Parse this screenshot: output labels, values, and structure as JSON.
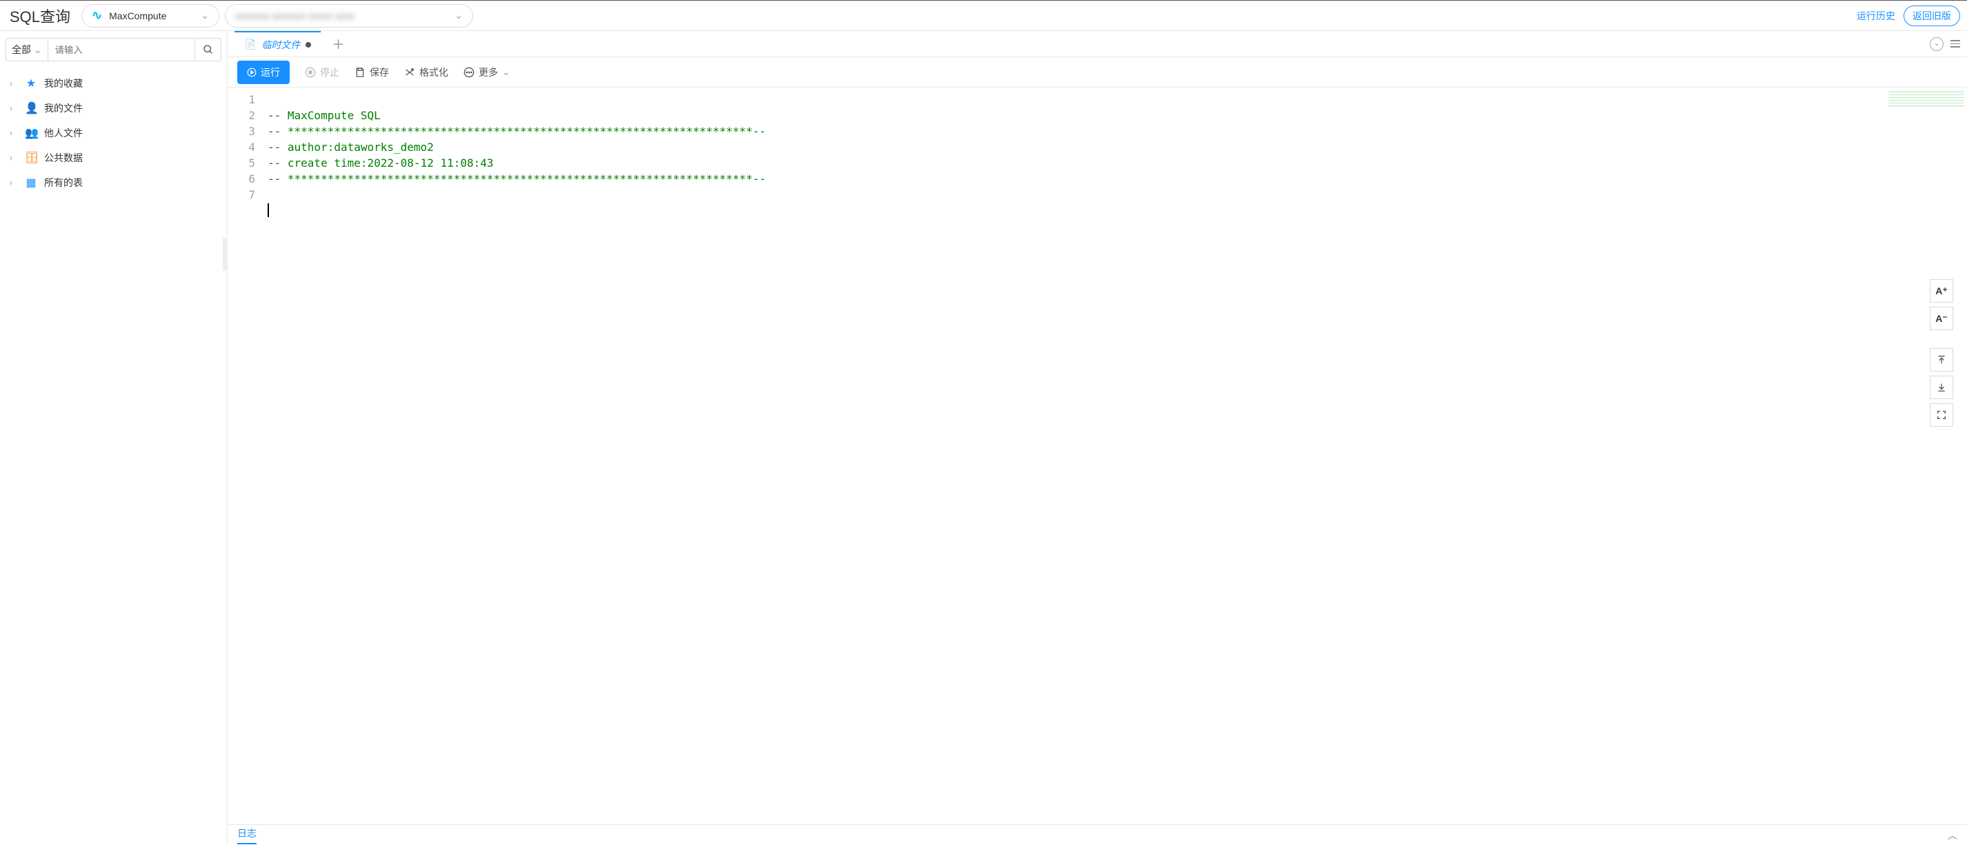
{
  "header": {
    "title": "SQL查询",
    "engine": "MaxCompute",
    "workspace_blur": "xxxxxxx  xxxxxxx  xxxxx  xxxx",
    "history_link": "运行历史",
    "return_old": "返回旧版"
  },
  "sidebar": {
    "scope": "全部",
    "search_placeholder": "请输入",
    "items": [
      {
        "icon": "star",
        "label": "我的收藏"
      },
      {
        "icon": "user",
        "label": "我的文件"
      },
      {
        "icon": "users",
        "label": "他人文件"
      },
      {
        "icon": "db",
        "label": "公共数据"
      },
      {
        "icon": "grid",
        "label": "所有的表"
      }
    ]
  },
  "tabs": {
    "active": "临时文件"
  },
  "toolbar": {
    "run": "运行",
    "stop": "停止",
    "save": "保存",
    "format": "格式化",
    "more": "更多"
  },
  "editor": {
    "lines": [
      "-- MaxCompute SQL",
      "-- **********************************************************************--",
      "-- author:dataworks_demo2",
      "-- create time:2022-08-12 11:08:43",
      "-- **********************************************************************--",
      "",
      ""
    ]
  },
  "side_tools": {
    "zoom_in": "A⁺",
    "zoom_out": "A⁻"
  },
  "bottom": {
    "log": "日志"
  }
}
